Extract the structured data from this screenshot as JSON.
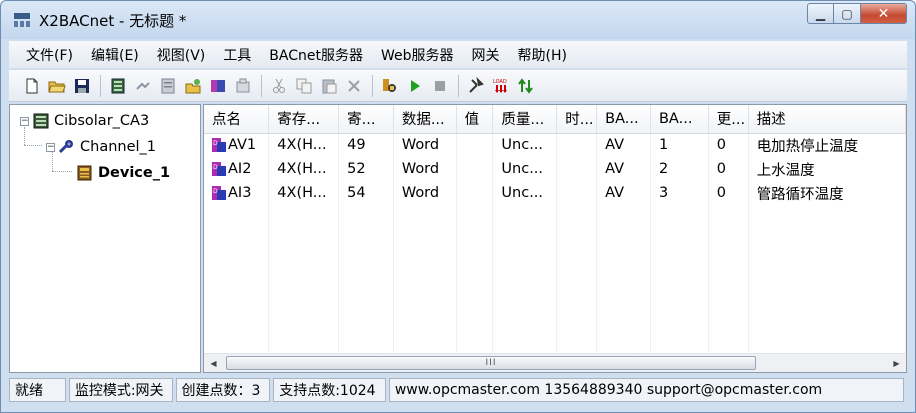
{
  "window": {
    "title": "X2BACnet - 无标题 *"
  },
  "menu": [
    "文件(F)",
    "编辑(E)",
    "视图(V)",
    "工具",
    "BACnet服务器",
    "Web服务器",
    "网关",
    "帮助(H)"
  ],
  "toolbar": {
    "icons": [
      "new-file-icon",
      "open-folder-icon",
      "save-icon",
      "add-channel-icon",
      "add-device-icon",
      "add-tag-icon",
      "open-project-icon",
      "import-icon",
      "properties-icon",
      "cut-icon",
      "copy-icon",
      "paste-icon",
      "delete-icon",
      "monitor-icon",
      "run-icon",
      "stop-icon",
      "tools-icon",
      "load-icon",
      "up-download-icon"
    ]
  },
  "tree": {
    "root": "Cibsolar_CA3",
    "channel": "Channel_1",
    "device": "Device_1"
  },
  "table": {
    "headers": [
      "点名",
      "寄存...",
      "寄...",
      "数据...",
      "值",
      "质量...",
      "时...",
      "BA...",
      "BA...",
      "更...",
      "描述"
    ],
    "rows": [
      [
        "AV1",
        "4X(H...",
        "49",
        "Word",
        "",
        "Unc...",
        "",
        "AV",
        "1",
        "0",
        "电加热停止温度"
      ],
      [
        "AI2",
        "4X(H...",
        "52",
        "Word",
        "",
        "Unc...",
        "",
        "AV",
        "2",
        "0",
        "上水温度"
      ],
      [
        "AI3",
        "4X(H...",
        "54",
        "Word",
        "",
        "Unc...",
        "",
        "AV",
        "3",
        "0",
        "管路循环温度"
      ]
    ]
  },
  "scrollbar": {
    "grip": "III"
  },
  "status": {
    "ready": "就绪",
    "mode": "监控模式:网关",
    "created": "创建点数：3",
    "supported": "支持点数:1024",
    "contact": "www.opcmaster.com 13564889340 support@opcmaster.com"
  },
  "colors": {
    "titlebar": "#c4d7ee",
    "close": "#c44a32",
    "frame": "#cfdff0"
  }
}
